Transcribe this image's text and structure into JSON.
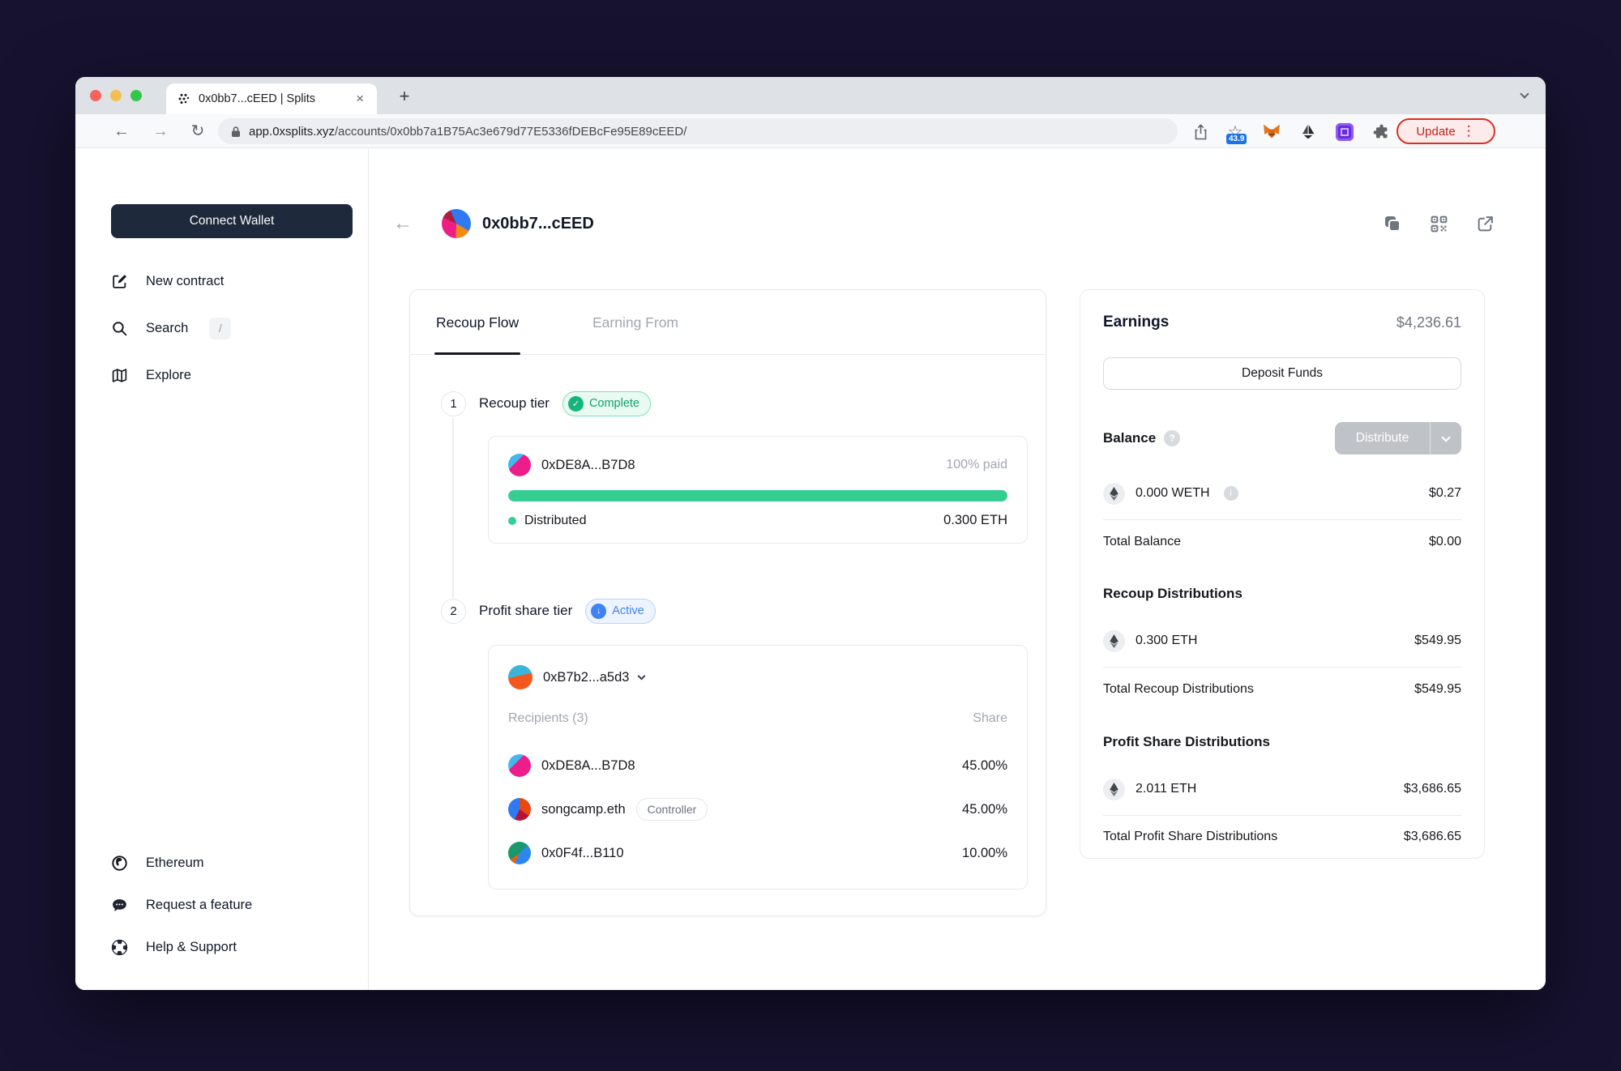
{
  "browser": {
    "tab_title": "0x0bb7...cEED | Splits",
    "url_domain": "app.0xsplits.xyz",
    "url_path": "/accounts/0x0bb7a1B75Ac3e679d77E5336fDEBcFe95E89cEED/",
    "extension_badge": "43.9",
    "update_label": "Update"
  },
  "icons": {
    "back": "←",
    "forward": "→",
    "reload": "↻",
    "star": "☆",
    "plus": "+",
    "close": "×",
    "kebab": "⋮",
    "check": "✓",
    "down_arrow": "↓",
    "question": "?",
    "info": "i",
    "slash": "/"
  },
  "sidebar": {
    "connect_wallet_label": "Connect Wallet",
    "items": [
      {
        "label": "New contract"
      },
      {
        "label": "Search"
      },
      {
        "label": "Explore"
      }
    ],
    "footer_items": [
      {
        "label": "Ethereum"
      },
      {
        "label": "Request a feature"
      },
      {
        "label": "Help & Support"
      }
    ]
  },
  "header": {
    "title": "0x0bb7...cEED"
  },
  "flow": {
    "tabs": [
      {
        "label": "Recoup Flow"
      },
      {
        "label": "Earning From"
      }
    ],
    "step1": {
      "number": "1",
      "title": "Recoup tier",
      "badge": "Complete"
    },
    "step2": {
      "number": "2",
      "title": "Profit share tier",
      "badge": "Active"
    },
    "recoup_card": {
      "address": "0xDE8A...B7D8",
      "paid_label": "100% paid",
      "progress_pct": 100,
      "progress_style": "width:100%",
      "status_label": "Distributed",
      "amount": "0.300 ETH"
    },
    "profit_card": {
      "address": "0xB7b2...a5d3",
      "recipients_label": "Recipients (3)",
      "share_label": "Share",
      "recipients": [
        {
          "name": "0xDE8A...B7D8",
          "share": "45.00%"
        },
        {
          "name": "songcamp.eth",
          "tag": "Controller",
          "share": "45.00%"
        },
        {
          "name": "0x0F4f...B110",
          "share": "10.00%"
        }
      ]
    }
  },
  "panel": {
    "title": "Earnings",
    "total": "$4,236.61",
    "deposit_label": "Deposit Funds",
    "balance_label": "Balance",
    "distribute_label": "Distribute",
    "weth_row": {
      "amount": "0.000 WETH",
      "usd": "$0.27"
    },
    "total_balance_label": "Total Balance",
    "total_balance_usd": "$0.00",
    "recoup": {
      "title": "Recoup Distributions",
      "row": {
        "amount": "0.300 ETH",
        "usd": "$549.95"
      },
      "total_label": "Total Recoup Distributions",
      "total_usd": "$549.95"
    },
    "profit": {
      "title": "Profit Share Distributions",
      "row": {
        "amount": "2.011 ETH",
        "usd": "$3,686.65"
      },
      "total_label": "Total Profit Share Distributions",
      "total_usd": "$3,686.65"
    }
  },
  "avatars": {
    "account": "background:conic-gradient(#2f7af0 0deg 120deg, #f18a15 120deg 182deg, #ef1e86 182deg 295deg, #a8203c 295deg 336deg, #2f7af0 336deg 360deg)",
    "de8a": "background:linear-gradient(135deg, #11535b 0%, #11535b 16%, #41b9ee 16%, #41b9ee 36%, #ec1e8c 36%, #ec1e8c 100%)",
    "b7b2": "background:linear-gradient(168deg, #3ab5d9 0%, #3ab5d9 44%, #f4571d 44%, #f4571d 100%)",
    "songcamp": "background:conic-gradient(#e8490f 0deg 125deg, #b51237 125deg 205deg, #2f7af0 205deg 360deg)",
    "f4f0": "background:conic-gradient(#17996b 0deg 45deg, #2e86f0 45deg 205deg, #e2610f 205deg 235deg, #17996b 235deg 360deg)"
  },
  "colors": {
    "progress_green": "#35cd92",
    "active_blue": "#3f82f6",
    "connect_navy": "#1e2a3b",
    "update_red": "#c5221f"
  }
}
